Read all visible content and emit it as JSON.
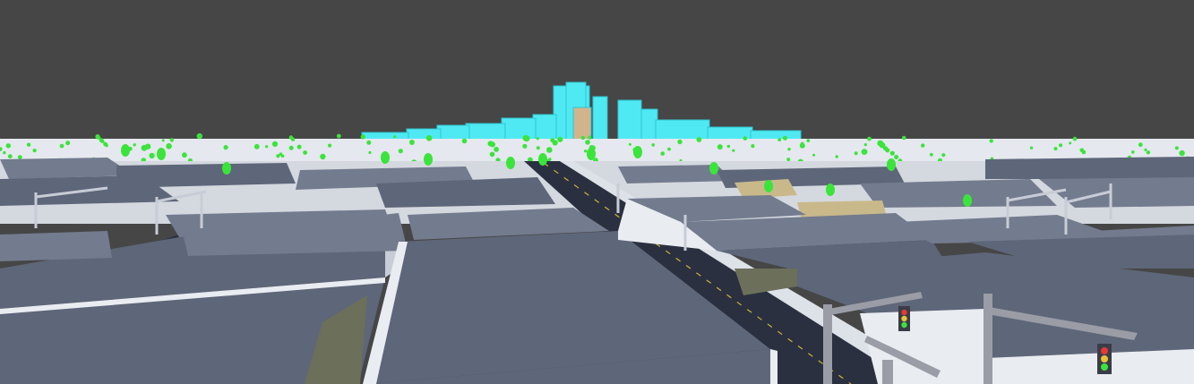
{
  "scene": {
    "description_visible_text": [],
    "colors": {
      "sky": "#464646",
      "roof": "#5e6679",
      "roof_light": "#737b8e",
      "wall": "#e9ecf1",
      "wall_shade": "#c8ccd6",
      "road": "#2b3040",
      "ground": "#6c6f5a",
      "tree": "#3be43b",
      "skyline": "#4fe9f3",
      "sand": "#c9b98a",
      "pole": "#9a9ca6"
    },
    "traffic_light_icon": "traffic-light-icon"
  }
}
